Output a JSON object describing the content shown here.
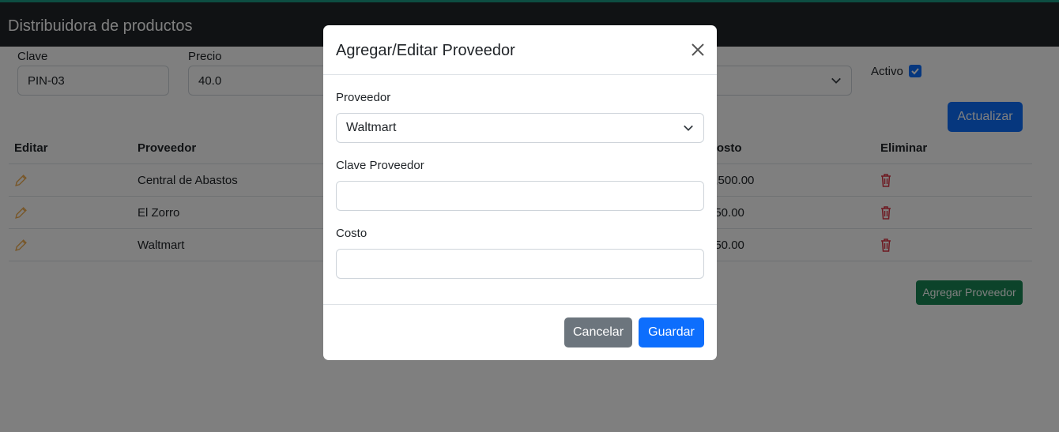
{
  "navbar": {
    "brand": "Distribuidora de productos"
  },
  "form": {
    "clave_label": "Clave",
    "clave_value": "PIN-03",
    "precio_label": "Precio",
    "precio_value": "40.0",
    "activo_label": "Activo",
    "activo_checked": true,
    "update_button": "Actualizar"
  },
  "table": {
    "headers": [
      "Editar",
      "Proveedor",
      "Costo",
      "Eliminar"
    ],
    "rows": [
      {
        "proveedor": "Central de Abastos",
        "costo": "1,500.00"
      },
      {
        "proveedor": "El Zorro",
        "costo": "150.00"
      },
      {
        "proveedor": "Waltmart",
        "costo": "150.00"
      }
    ]
  },
  "add_supplier_button": "Agregar Proveedor",
  "modal": {
    "title": "Agregar/Editar Proveedor",
    "proveedor_label": "Proveedor",
    "proveedor_selected": "Waltmart",
    "clave_label": "Clave Proveedor",
    "clave_value": "",
    "costo_label": "Costo",
    "costo_value": "",
    "cancel_button": "Cancelar",
    "save_button": "Guardar"
  },
  "colors": {
    "primary": "#0d6efd",
    "success": "#198754",
    "secondary": "#6c757d",
    "danger": "#dc3545",
    "edit_icon": "#f0ad4e",
    "navbar": "#212529"
  },
  "icons": [
    "pencil-icon",
    "trash-icon",
    "close-icon",
    "chevron-down-icon",
    "check-icon"
  ]
}
